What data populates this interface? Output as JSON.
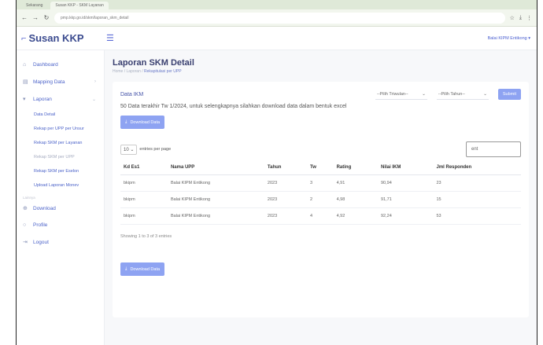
{
  "browser": {
    "tabs": [
      "Sekarang",
      "Susan KKP - SKM Layanan"
    ],
    "url": "pmp.kkp.go.id/skm/laporan_skm_detail"
  },
  "header": {
    "brand": "Susan KKP",
    "user": "Balai KIPM Entikong ▾"
  },
  "sidebar": {
    "items": [
      {
        "label": "Dashboard",
        "icon": "home-icon"
      },
      {
        "label": "Mapping Data",
        "icon": "mapping-icon"
      },
      {
        "label": "Laporan",
        "icon": "report-icon"
      }
    ],
    "subitems": [
      "Data Detail",
      "Rekap per UPP per Unsur",
      "Rekap SKM per Layanan",
      "Rekap SKM per UPP",
      "Rekap SKM per Eselon",
      "Upload Laporan Monev"
    ],
    "separator": "Lainnya",
    "bottom": [
      {
        "label": "Download",
        "icon": "download-icon"
      },
      {
        "label": "Profile",
        "icon": "user-icon"
      },
      {
        "label": "Logout",
        "icon": "logout-icon"
      }
    ]
  },
  "page": {
    "title": "Laporan SKM Detail",
    "breadcrumb_home": "Home / Laporan /",
    "breadcrumb_current": "Rekapitulasi per UPP"
  },
  "card": {
    "title": "Data IKM",
    "select_triwulan": "--Pilih Triwulan--",
    "select_tahun": "--Pilih Tahun--",
    "submit": "Submit",
    "info": "50 Data terakhir Tw 1/2024, untuk selengkapnya silahkan download data dalam bentuk excel",
    "download": "Download Data",
    "entries_value": "10",
    "entries_label": "entries per page",
    "search_value": "ent",
    "columns": [
      "Kd Es1",
      "Nama UPP",
      "Tahun",
      "Tw",
      "Rating",
      "Nilai IKM",
      "Jml Responden"
    ],
    "rows": [
      [
        "bkipm",
        "Balai KIPM Entikong",
        "2023",
        "3",
        "4,91",
        "90,94",
        "23"
      ],
      [
        "bkipm",
        "Balai KIPM Entikong",
        "2023",
        "2",
        "4,98",
        "91,71",
        "15"
      ],
      [
        "bkipm",
        "Balai KIPM Entikong",
        "2023",
        "4",
        "4,92",
        "92,24",
        "53"
      ]
    ],
    "showing": "Showing 1 to 3 of 3 entries"
  }
}
